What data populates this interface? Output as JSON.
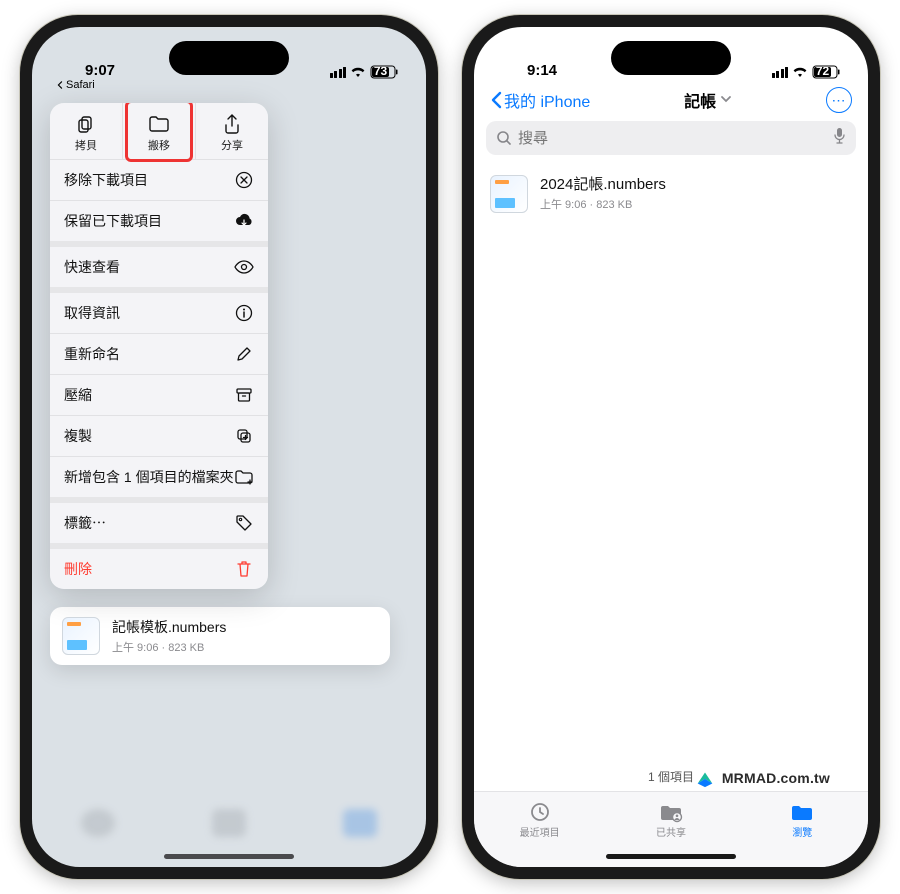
{
  "left": {
    "status": {
      "time": "9:07",
      "battery": "73"
    },
    "back_app": "Safari",
    "ctx_top": [
      {
        "label": "拷貝",
        "icon": "copy"
      },
      {
        "label": "搬移",
        "icon": "folder",
        "highlight": true
      },
      {
        "label": "分享",
        "icon": "share"
      }
    ],
    "ctx_rows": [
      {
        "label": "移除下載項目",
        "icon": "x-circle",
        "sep": false
      },
      {
        "label": "保留已下載項目",
        "icon": "cloud-down",
        "sep": false
      },
      {
        "label": "快速查看",
        "icon": "eye",
        "sep": true
      },
      {
        "label": "取得資訊",
        "icon": "info",
        "sep": true
      },
      {
        "label": "重新命名",
        "icon": "pencil",
        "sep": false
      },
      {
        "label": "壓縮",
        "icon": "archive",
        "sep": false
      },
      {
        "label": "複製",
        "icon": "dup",
        "sep": false
      },
      {
        "label": "新增包含 1 個項目的檔案夾",
        "icon": "folder-plus",
        "sep": false
      },
      {
        "label": "標籤⋯",
        "icon": "tag",
        "sep": true
      },
      {
        "label": "刪除",
        "icon": "trash",
        "sep": true,
        "danger": true
      }
    ],
    "file": {
      "name": "記帳模板.numbers",
      "sub": "上午 9:06 · 823 KB"
    }
  },
  "right": {
    "status": {
      "time": "9:14",
      "battery": "72"
    },
    "nav": {
      "back": "我的 iPhone",
      "title": "記帳"
    },
    "search_placeholder": "搜尋",
    "file": {
      "name": "2024記帳.numbers",
      "sub": "上午 9:06 · 823 KB"
    },
    "count": "1 個項目",
    "tabs": [
      {
        "label": "最近項目"
      },
      {
        "label": "已共享"
      },
      {
        "label": "瀏覽",
        "active": true
      }
    ]
  },
  "watermark": "MRMAD.com.tw"
}
